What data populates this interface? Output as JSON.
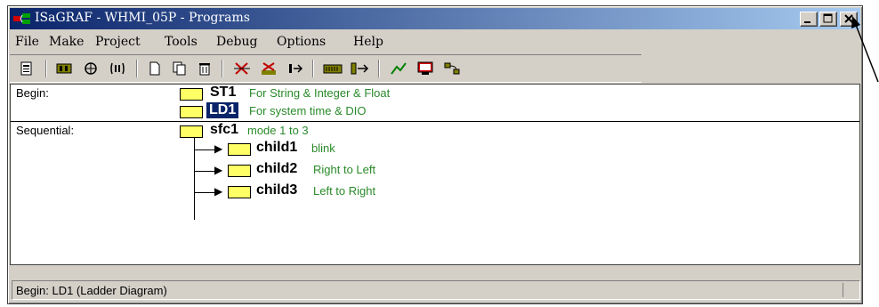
{
  "window": {
    "title": "ISaGRAF - WHMI_05P - Programs",
    "title_bar_gradient": [
      "#0a246a",
      "#a6caf0"
    ],
    "controls": [
      "minimize-icon",
      "maximize-icon",
      "close-icon"
    ]
  },
  "menu": [
    "File",
    "Make",
    "Project",
    "Tools",
    "Debug",
    "Options",
    "Help"
  ],
  "toolbar": {
    "buttons": [
      "properties-icon",
      "dictionary-icon",
      "io-connection-icon",
      "variables-icon",
      "new-program-icon",
      "copy-icon",
      "delete-icon",
      "compile-icon",
      "verify-icon",
      "link-icon",
      "keyboard-icon",
      "io-icon",
      "debug-icon",
      "simulate-icon",
      "download-icon"
    ]
  },
  "sections": {
    "begin_label": "Begin:",
    "sequential_label": "Sequential:"
  },
  "programs": {
    "st1": {
      "name": "ST1",
      "comment": "For String & Integer & Float",
      "icon": "st-program-icon"
    },
    "ld1": {
      "name": "LD1",
      "comment": "For system time & DIO",
      "icon": "ld-program-icon"
    },
    "sfc1": {
      "name": "sfc1",
      "comment": "mode 1 to 3",
      "icon": "sfc-program-icon"
    },
    "child1": {
      "name": "child1",
      "comment": "blink",
      "icon": "sfc-program-icon"
    },
    "child2": {
      "name": "child2",
      "comment": "Right to Left",
      "icon": "sfc-program-icon"
    },
    "child3": {
      "name": "child3",
      "comment": "Left to Right",
      "icon": "sfc-program-icon"
    }
  },
  "status": {
    "text": "Begin:  LD1  (Ladder Diagram)"
  },
  "colors": {
    "comment_green": "#2a8a2a",
    "selection_blue": "#0a246a",
    "window_face": "#d4d0c8"
  }
}
